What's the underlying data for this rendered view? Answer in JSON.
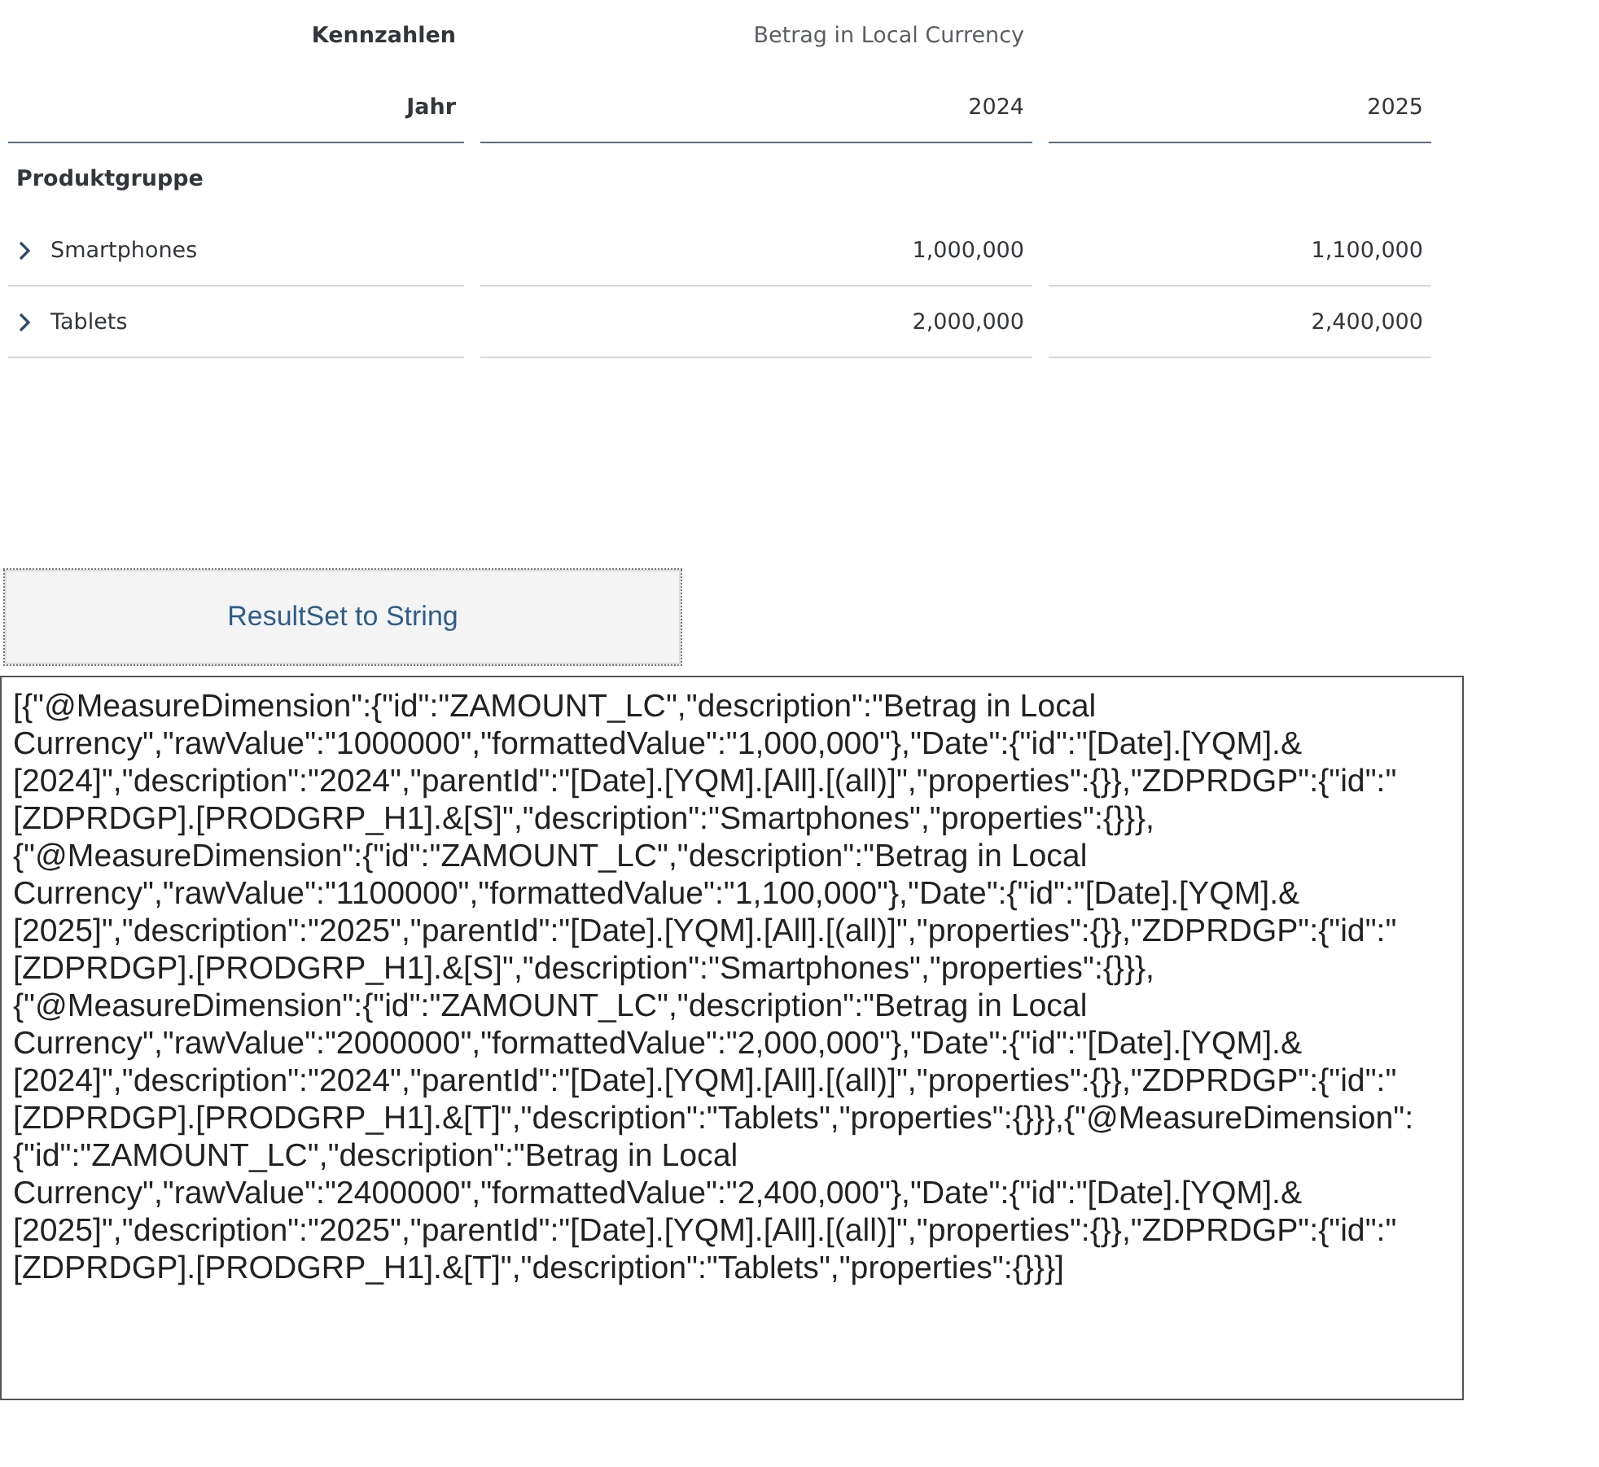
{
  "table": {
    "measure_label": "Kennzahlen",
    "measure": "Betrag in Local Currency",
    "year_label": "Jahr",
    "years": [
      "2024",
      "2025"
    ],
    "dimension_label": "Produktgruppe",
    "rows": [
      {
        "label": "Smartphones",
        "expanded": false,
        "values": [
          "1,000,000",
          "1,100,000"
        ]
      },
      {
        "label": "Tablets",
        "expanded": false,
        "values": [
          "2,000,000",
          "2,400,000"
        ]
      }
    ]
  },
  "button": "ResultSet to String",
  "output_text": "[{\"@MeasureDimension\":{\"id\":\"ZAMOUNT_LC\",\"description\":\"Betrag in Local Currency\",\"rawValue\":\"1000000\",\"formattedValue\":\"1,000,000\"},\"Date\":{\"id\":\"[Date].[YQM].&[2024]\",\"description\":\"2024\",\"parentId\":\"[Date].[YQM].[All].[(all)]\",\"properties\":{}},\"ZDPRDGP\":{\"id\":\"[ZDPRDGP].[PRODGRP_H1].&[S]\",\"description\":\"Smartphones\",\"properties\":{}}},{\"@MeasureDimension\":{\"id\":\"ZAMOUNT_LC\",\"description\":\"Betrag in Local Currency\",\"rawValue\":\"1100000\",\"formattedValue\":\"1,100,000\"},\"Date\":{\"id\":\"[Date].[YQM].&[2025]\",\"description\":\"2025\",\"parentId\":\"[Date].[YQM].[All].[(all)]\",\"properties\":{}},\"ZDPRDGP\":{\"id\":\"[ZDPRDGP].[PRODGRP_H1].&[S]\",\"description\":\"Smartphones\",\"properties\":{}}},{\"@MeasureDimension\":{\"id\":\"ZAMOUNT_LC\",\"description\":\"Betrag in Local Currency\",\"rawValue\":\"2000000\",\"formattedValue\":\"2,000,000\"},\"Date\":{\"id\":\"[Date].[YQM].&[2024]\",\"description\":\"2024\",\"parentId\":\"[Date].[YQM].[All].[(all)]\",\"properties\":{}},\"ZDPRDGP\":{\"id\":\"[ZDPRDGP].[PRODGRP_H1].&[T]\",\"description\":\"Tablets\",\"properties\":{}}},{\"@MeasureDimension\":{\"id\":\"ZAMOUNT_LC\",\"description\":\"Betrag in Local Currency\",\"rawValue\":\"2400000\",\"formattedValue\":\"2,400,000\"},\"Date\":{\"id\":\"[Date].[YQM].&[2025]\",\"description\":\"2025\",\"parentId\":\"[Date].[YQM].[All].[(all)]\",\"properties\":{}},\"ZDPRDGP\":{\"id\":\"[ZDPRDGP].[PRODGRP_H1].&[T]\",\"description\":\"Tablets\",\"properties\":{}}}]"
}
